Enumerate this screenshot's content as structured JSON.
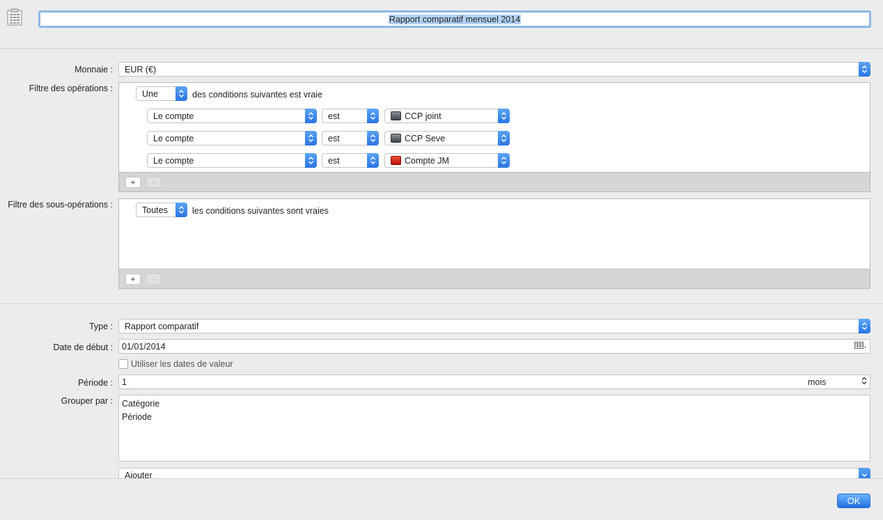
{
  "header": {
    "title": "Rapport comparatif mensuel 2014"
  },
  "currency": {
    "label": "Monnaie :",
    "value": "EUR (€)"
  },
  "ops_filter": {
    "label": "Filtre des opérations :",
    "match": "Une",
    "match_suffix": "des conditions suivantes est vraie",
    "rules": [
      {
        "field": "Le compte",
        "op": "est",
        "value": "CCP joint",
        "icon": "bank-card-icon"
      },
      {
        "field": "Le compte",
        "op": "est",
        "value": "CCP Seve",
        "icon": "bank-card-icon"
      },
      {
        "field": "Le compte",
        "op": "est",
        "value": "Compte JM",
        "icon": "bank-logo-icon"
      }
    ],
    "add": "+",
    "remove": "-"
  },
  "subops_filter": {
    "label": "Filtre des sous-opérations :",
    "match": "Toutes",
    "match_suffix": "les conditions suivantes sont vraies",
    "add": "+",
    "remove": "-"
  },
  "type": {
    "label": "Type :",
    "value": "Rapport comparatif"
  },
  "start_date": {
    "label": "Date de début :",
    "value": "01/01/2014"
  },
  "value_dates": {
    "label": "Utiliser les dates de valeur",
    "checked": false
  },
  "period": {
    "label": "Période :",
    "value": "1",
    "unit": "mois"
  },
  "group_by": {
    "label": "Grouper par :",
    "items": [
      "Catégorie",
      "Période"
    ],
    "add_label": "Ajouter"
  },
  "ok_label": "OK",
  "colors": {
    "accent": "#2a76e4",
    "selection": "#b3d2f7"
  }
}
